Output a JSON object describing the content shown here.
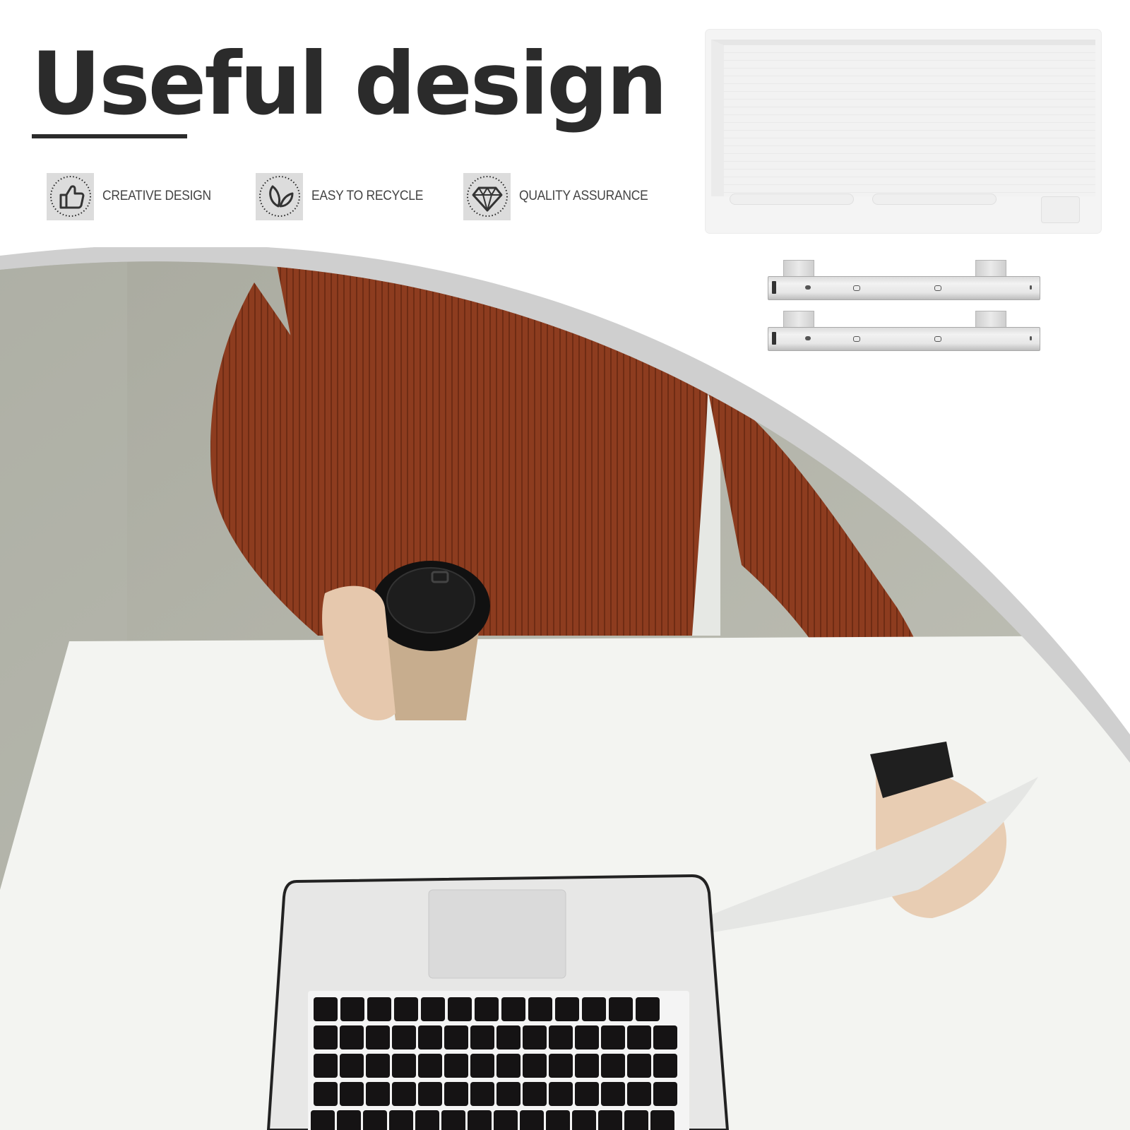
{
  "headline": {
    "title": "Useful design"
  },
  "features": [
    {
      "icon": "thumbs-up-icon",
      "label": "CREATIVE DESIGN"
    },
    {
      "icon": "leaf-icon",
      "label": "EASY TO RECYCLE"
    },
    {
      "icon": "diamond-icon",
      "label": "QUALITY ASSURANCE"
    }
  ],
  "product": {
    "items": [
      "keyboard drawer tray",
      "drawer slide rail",
      "drawer slide rail"
    ]
  },
  "colors": {
    "heading": "#2b2b2b",
    "icon_box": "#dcdcdc",
    "arc_band": "#cfcfcf",
    "sweater": "#8a3a1e",
    "desk": "#f3f4f1"
  }
}
